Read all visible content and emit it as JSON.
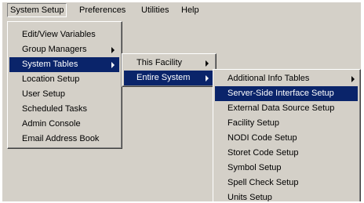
{
  "menubar": {
    "items": [
      "System Setup",
      "Preferences",
      "Utilities",
      "Help"
    ]
  },
  "system_setup_menu": {
    "items": [
      "Edit/View Variables",
      "Group Managers",
      "System Tables",
      "Location Setup",
      "User Setup",
      "Scheduled Tasks",
      "Admin Console",
      "Email Address Book"
    ]
  },
  "system_tables_menu": {
    "items": [
      "This Facility",
      "Entire System"
    ]
  },
  "entire_system_menu": {
    "items": [
      "Additional Info Tables",
      "Server-Side Interface Setup",
      "External Data Source Setup",
      "Facility Setup",
      "NODI Code Setup",
      "Storet Code Setup",
      "Symbol Setup",
      "Spell Check Setup",
      "Units Setup"
    ]
  },
  "colors": {
    "menu_face": "#d4d0c8",
    "selection": "#0a246a",
    "selection_text": "#ffffff"
  }
}
